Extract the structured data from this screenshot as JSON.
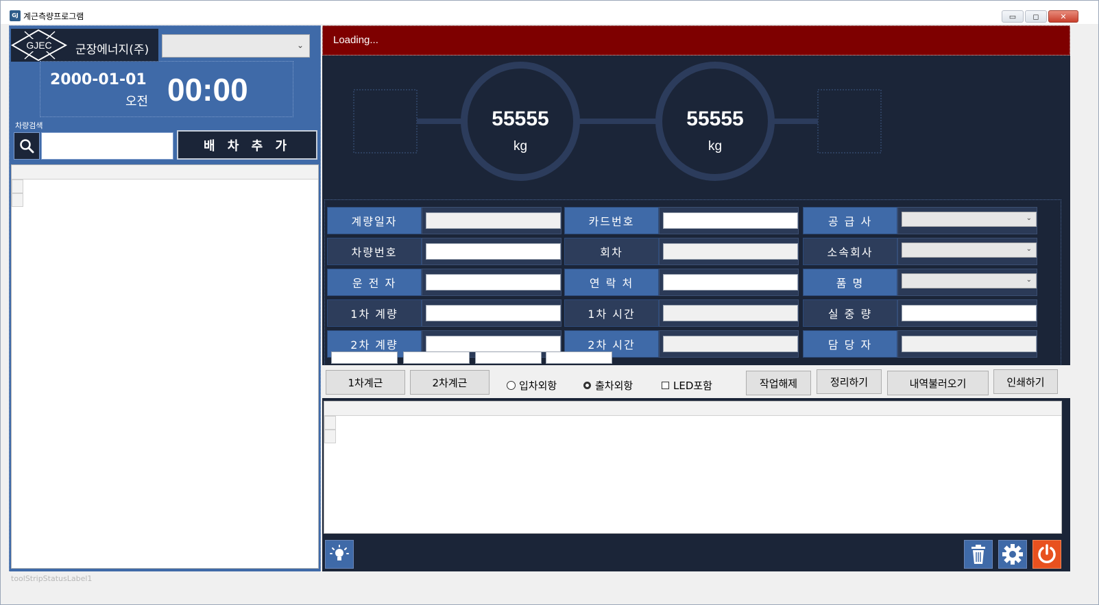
{
  "window": {
    "title": "계근측량프로그램",
    "icon_text": "GJ"
  },
  "left": {
    "logo_mark": "GJEC",
    "company": "군장에너지(주)",
    "date": "2000-01-01",
    "ampm": "오전",
    "clock": "00:00",
    "search_label": "차량검색",
    "search_value": "",
    "add_button": "배 차 추 가"
  },
  "loading": "Loading...",
  "scales": [
    {
      "value": "55555",
      "unit": "kg"
    },
    {
      "value": "55555",
      "unit": "kg"
    }
  ],
  "form": {
    "weigh_date": "계량일자",
    "card_no": "카드번호",
    "supplier": "공 급 사",
    "vehicle_no": "차량번호",
    "round": "회차",
    "affiliate": "소속회사",
    "driver": "운 전 자",
    "contact": "연 락 처",
    "product": "품 명",
    "first_weigh": "1차 계량",
    "first_time": "1차 시간",
    "net_weight": "실 중 량",
    "second_weigh": "2차 계량",
    "second_time": "2차 시간",
    "manager": "담 당 자"
  },
  "buttons": {
    "first": "1차계근",
    "second": "2차계근",
    "release": "작업해제",
    "cleanup": "정리하기",
    "load_history": "내역불러오기",
    "print": "인쇄하기"
  },
  "options": {
    "in_exclude": "입차외항",
    "out_exclude": "출차외항",
    "led_include": "LED포함"
  },
  "status": "toolStripStatusLabel1",
  "icons": {
    "search": "search-icon",
    "light": "lightbulb-icon",
    "trash": "trash-icon",
    "settings": "gear-icon",
    "power": "power-icon"
  }
}
